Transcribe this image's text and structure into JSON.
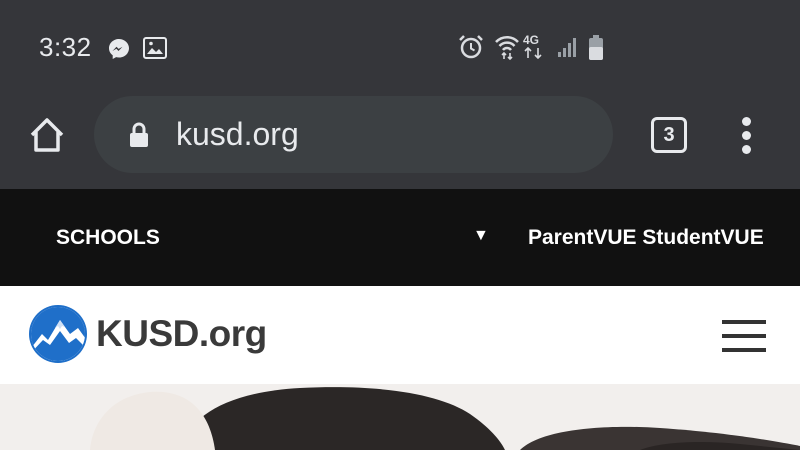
{
  "status_bar": {
    "time": "3:32",
    "network": "4G",
    "icons": [
      "messenger-icon",
      "gallery-icon",
      "alarm-icon",
      "wifi-icon",
      "signal-icon",
      "battery-icon"
    ]
  },
  "browser": {
    "url": "kusd.org",
    "tab_count": "3",
    "icons": [
      "home-icon",
      "lock-icon",
      "tabs-icon",
      "more-vert-icon"
    ]
  },
  "site_nav": {
    "schools_label": "SCHOOLS",
    "caret": "▼",
    "links_label": "ParentVUE StudentVUE"
  },
  "site_header": {
    "logo_text": "KUSD.org",
    "icons": [
      "kusd-logo-icon",
      "hamburger-menu-icon"
    ]
  },
  "colors": {
    "chrome_bg": "#35363a",
    "omnibox_bg": "#3c4043",
    "nav_bg": "#111111",
    "logo_blue": "#1f6fc9"
  }
}
